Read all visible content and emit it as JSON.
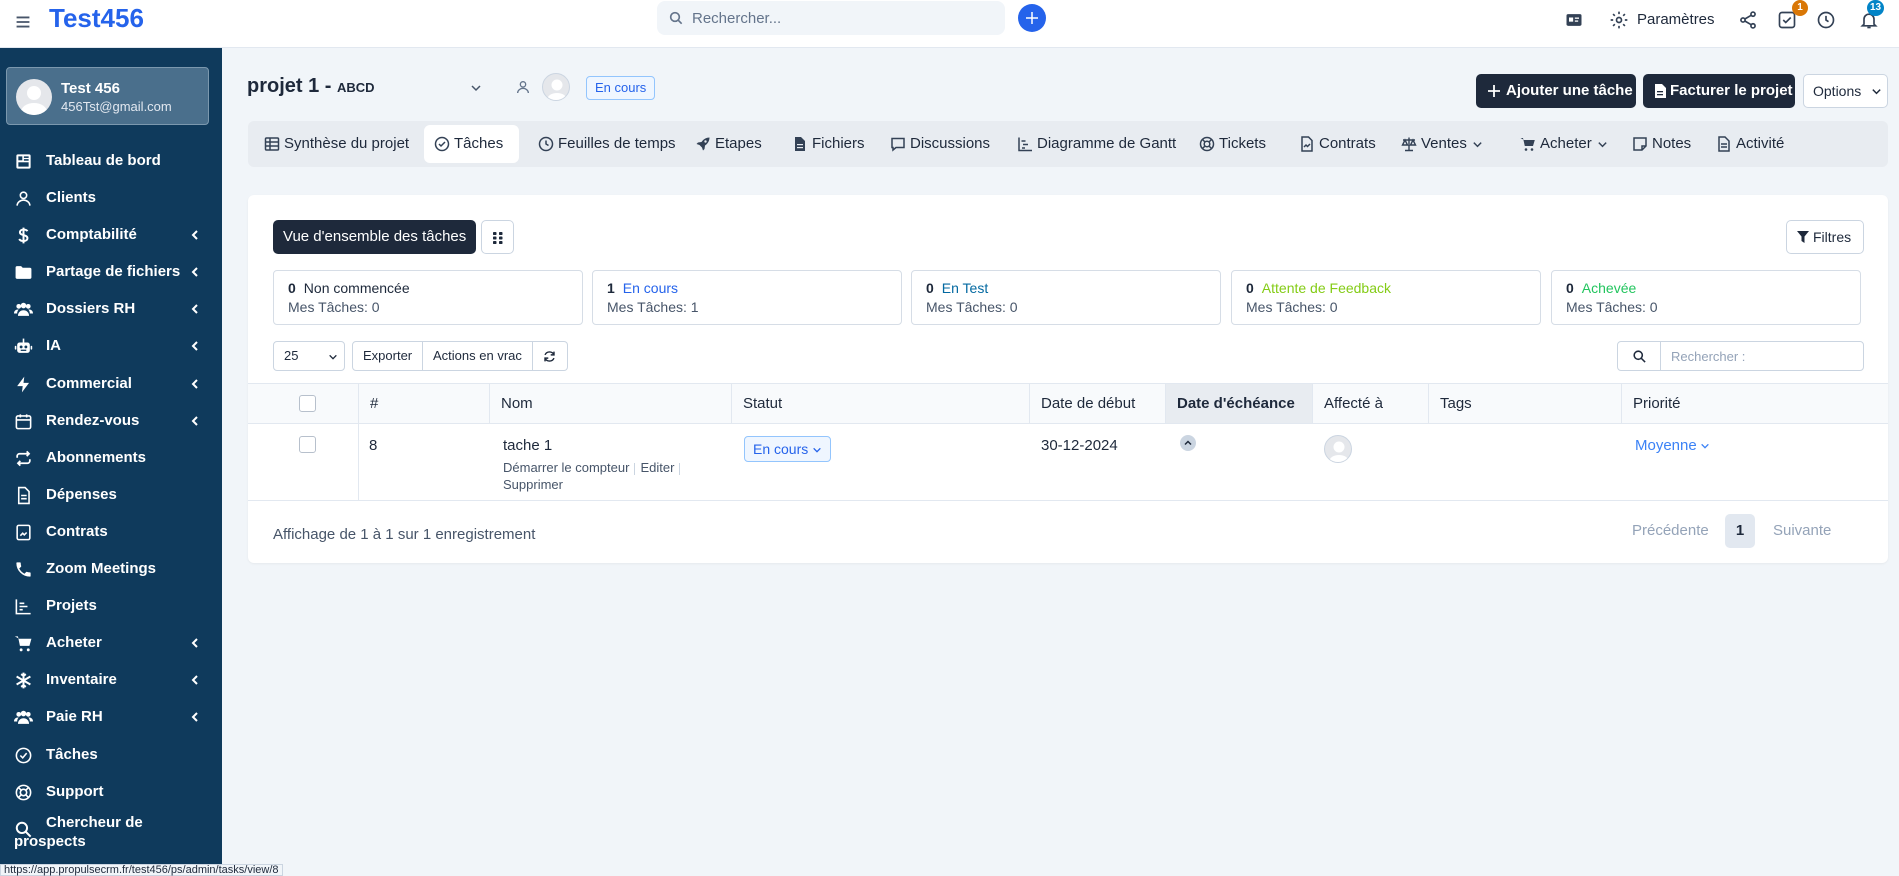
{
  "app": {
    "brand": "Test456"
  },
  "topbar": {
    "search_placeholder": "Rechercher...",
    "settings_label": "Paramètres",
    "tasks_badge": "1",
    "notifications_badge": "13"
  },
  "user": {
    "name": "Test 456",
    "email": "456Tst@gmail.com"
  },
  "sidebar": {
    "items": [
      {
        "label": "Tableau de bord",
        "icon": "dashboard-icon"
      },
      {
        "label": "Clients",
        "icon": "user-icon"
      },
      {
        "label": "Comptabilité",
        "icon": "dollar-icon",
        "has_submenu": true
      },
      {
        "label": "Partage de fichiers",
        "icon": "folder-icon",
        "has_submenu": true
      },
      {
        "label": "Dossiers RH",
        "icon": "users-icon",
        "has_submenu": true
      },
      {
        "label": "IA",
        "icon": "robot-icon",
        "has_submenu": true
      },
      {
        "label": "Commercial",
        "icon": "bolt-icon",
        "has_submenu": true
      },
      {
        "label": "Rendez-vous",
        "icon": "calendar-icon",
        "has_submenu": true
      },
      {
        "label": "Abonnements",
        "icon": "repeat-icon"
      },
      {
        "label": "Dépenses",
        "icon": "file-icon"
      },
      {
        "label": "Contrats",
        "icon": "contract-icon"
      },
      {
        "label": "Zoom Meetings",
        "icon": "phone-icon"
      },
      {
        "label": "Projets",
        "icon": "chart-icon"
      },
      {
        "label": "Acheter",
        "icon": "cart-icon",
        "has_submenu": true
      },
      {
        "label": "Inventaire",
        "icon": "snowflake-icon",
        "has_submenu": true
      },
      {
        "label": "Paie RH",
        "icon": "users-icon",
        "has_submenu": true
      },
      {
        "label": "Tâches",
        "icon": "check-circle-icon"
      },
      {
        "label": "Support",
        "icon": "lifebuoy-icon"
      },
      {
        "label": "Chercheur de",
        "label2": "prospects",
        "icon": "search-icon"
      }
    ]
  },
  "project": {
    "title": "projet 1 -",
    "subtitle": "ABCD",
    "status": "En cours",
    "add_task_label": "Ajouter une tâche",
    "invoice_label": "Facturer le projet",
    "options_label": "Options"
  },
  "tabs": [
    {
      "label": "Synthèse du projet",
      "icon": "table-icon"
    },
    {
      "label": "Tâches",
      "icon": "check-circle-icon",
      "active": true
    },
    {
      "label": "Feuilles de temps",
      "icon": "clock-icon"
    },
    {
      "label": "Etapes",
      "icon": "rocket-icon"
    },
    {
      "label": "Fichiers",
      "icon": "file-icon"
    },
    {
      "label": "Discussions",
      "icon": "comment-icon"
    },
    {
      "label": "Diagramme de Gantt",
      "icon": "gantt-icon"
    },
    {
      "label": "Tickets",
      "icon": "lifebuoy-icon"
    },
    {
      "label": "Contrats",
      "icon": "contract-icon"
    },
    {
      "label": "Ventes",
      "icon": "balance-icon",
      "dropdown": true
    },
    {
      "label": "Acheter",
      "icon": "cart-icon",
      "dropdown": true
    },
    {
      "label": "Notes",
      "icon": "note-icon"
    },
    {
      "label": "Activité",
      "icon": "file-icon"
    }
  ],
  "overview": {
    "button_label": "Vue d'ensemble des tâches",
    "filters_label": "Filtres",
    "cards": [
      {
        "count": "0",
        "label": "Non commencée",
        "mine": "Mes Tâches: 0",
        "color": "#475569"
      },
      {
        "count": "1",
        "label": "En cours",
        "mine": "Mes Tâches: 1",
        "color": "#2563eb"
      },
      {
        "count": "0",
        "label": "En Test",
        "mine": "Mes Tâches: 0",
        "color": "#0369a1"
      },
      {
        "count": "0",
        "label": "Attente de Feedback",
        "mine": "Mes Tâches: 0",
        "color": "#84cc16"
      },
      {
        "count": "0",
        "label": "Achevée",
        "mine": "Mes Tâches: 0",
        "color": "#22c55e"
      }
    ]
  },
  "table": {
    "page_length": "25",
    "export_label": "Exporter",
    "bulk_label": "Actions en vrac",
    "search_placeholder": "Rechercher :",
    "columns": [
      "#",
      "Nom",
      "Statut",
      "Date de début",
      "Date d'échéance",
      "Affecté à",
      "Tags",
      "Priorité"
    ],
    "rows": [
      {
        "id": "8",
        "name": "tache 1",
        "action_start": "Démarrer le compteur",
        "action_edit": "Editer",
        "action_delete": "Supprimer",
        "status": "En cours",
        "start_date": "30-12-2024",
        "due_date": "",
        "tags": "",
        "priority": "Moyenne"
      }
    ],
    "info": "Affichage de 1 à 1 sur 1 enregistrement",
    "prev_label": "Précédente",
    "current_page": "1",
    "next_label": "Suivante"
  },
  "statusbar": {
    "url": "https://app.propulsecrm.fr/test456/ps/admin/tasks/view/8"
  },
  "colors": {
    "sidebar_bg": "#0f3a5c",
    "accent": "#2563eb",
    "dark_button": "#1e293b"
  }
}
